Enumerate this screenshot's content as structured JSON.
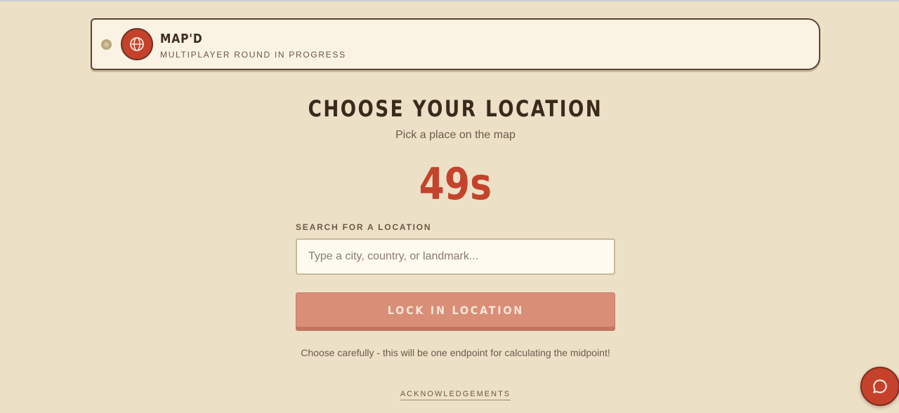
{
  "header": {
    "title": "MAP'D",
    "subtitle": "MULTIPLAYER ROUND IN PROGRESS",
    "logo_icon": "globe-icon",
    "status_icon": "status-dot-icon"
  },
  "main": {
    "title": "CHOOSE YOUR LOCATION",
    "subtitle": "Pick a place on the map",
    "timer": "49s",
    "search": {
      "label": "SEARCH FOR A LOCATION",
      "value": "",
      "placeholder": "Type a city, country, or landmark..."
    },
    "lock_button_label": "LOCK IN LOCATION",
    "hint": "Choose carefully - this will be one endpoint for calculating the midpoint!",
    "acknowledgements_link": "ACKNOWLEDGEMENTS"
  },
  "chat": {
    "icon": "chat-bubble-icon"
  },
  "colors": {
    "background": "#ece1c7",
    "accent": "#c6412b",
    "button": "#d98e77",
    "text_dark": "#3d2b1f"
  }
}
